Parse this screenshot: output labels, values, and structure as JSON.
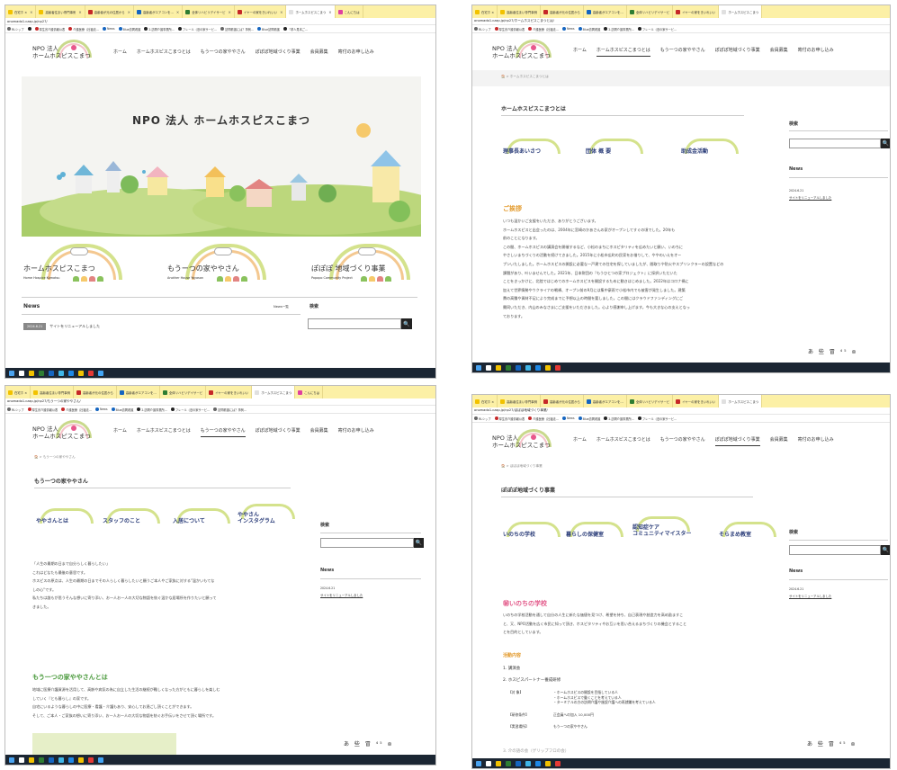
{
  "browser": {
    "tabs_long": [
      {
        "label": "在宅ホ ×",
        "color": "#f2c200"
      },
      {
        "label": "高齢者住まい専門事例",
        "color": "#f2c200"
      },
      {
        "label": "高齢者が元の住居から",
        "color": "#c62828"
      },
      {
        "label": "高齢者がエアコンを…",
        "color": "#1565c0"
      },
      {
        "label": "全体リハビリデイサービ",
        "color": "#2e7d32"
      },
      {
        "label": "イヤーの家をきいれいい",
        "color": "#c62828"
      },
      {
        "label": "ホームホスピスこまつ",
        "color": "#e0e0e0"
      },
      {
        "label": "こんにちは",
        "color": "#e040a0"
      }
    ],
    "bookmarks": [
      {
        "label": "RLシップ",
        "color": "#666"
      },
      {
        "label": "",
        "color": "#222"
      },
      {
        "label": "厚生省介護情報公表",
        "color": "#c62828"
      },
      {
        "label": "介護医療（社福法…",
        "color": "#c62828"
      },
      {
        "label": "News",
        "color": "#1565c0"
      },
      {
        "label": "Blue訪問看護",
        "color": "#1565c0"
      },
      {
        "label": "2.訪問介護事業所…",
        "color": "#222"
      },
      {
        "label": "フレール（旧の家サービ…",
        "color": "#222"
      },
      {
        "label": "訪問看護には？事例…",
        "color": "#666"
      },
      {
        "label": "Blue訪問看護",
        "color": "#1565c0"
      },
      {
        "label": "『求人見本ご…",
        "color": "#222"
      }
    ],
    "urls": [
      "onomado1.czap.jp/np27/",
      "onomado1.czap.jp/np27/ホームホスピスこまつとは/",
      "onomado1.czap.jp/np27/もう一つの家ややさん/",
      "onomado1.czap.jp/np27/ぽぽぽ地域づくり事業/"
    ]
  },
  "site": {
    "logo_line1": "NPO 法人",
    "logo_line2": "ホームホスピスこまつ",
    "nav": [
      "ホーム",
      "ホームホスピスこまつとは",
      "もう一つの家ややさん",
      "ぽぽぽ地域づくり事業",
      "会員募集",
      "寄付のお申し込み"
    ],
    "hero_title": "NPO 法人 ホームホスピスこまつ",
    "rainbow_cards": [
      {
        "main": "ホームホスピスこまつ",
        "sub": "Home Hospice Komatsu"
      },
      {
        "main": "もうーつの家ややさん",
        "sub": "Another House Yayasan"
      },
      {
        "main": "ぽぽぽ 地域づくり事業",
        "sub": "Popopo Community Project"
      }
    ],
    "news_heading": "News",
    "news_more": "News一覧",
    "search_heading": "検索",
    "news_date": "2024.6.21",
    "news_title": "サイトをリニューアルしました",
    "search_btn": "🔍"
  },
  "page_about": {
    "crumb": "🏠 > ホームホスピスこまつとは",
    "title": "ホームホスピスこまつとは",
    "buttons": [
      "理事長あいさつ",
      "団体 概 要",
      "助成金活動"
    ],
    "section": "ご挨拶",
    "para": [
      "いつも温かいご支援をいただき、ありがとうございます。",
      "ホームホスピスと出会ったのは、2004年に宮崎のかあさんの家がオープンしてすぐの頃でした。20年も",
      "前のことになります。",
      "この間、ホームホスピスの講演会を開催するなど、小松のまちにホスピタリティを広めたいと願い、いのちに",
      "やさしいまちづくりの活動を続けてきました。2015年に小松市広町の民家をお借りして、ややのいえをオー",
      "プンいたしました。ホームホスピスの開設に必要な一戸建ての住宅を探していましたが、間取りや防火やスプリンクラーの設置などの",
      "課題があり、叶いませんでした。2021年、日本財団の『もうひとつの家プロジェクト』に採択いただいた",
      "ことをきっかけに、北陸ではじめてのホームホスピスを開設するために動きはじめました。2022年はコロナ禍に",
      "加えて世界情勢やウクライナの戦禍、オープン前の9月には集中豪雨で小松市内でも被害が発生しました。建築",
      "費の高騰や資材不足により完成までに予想以上の時間を要しました。この間にはクラウドファンディングにご",
      "賛同いただき、内山のみなさまにご支援をいただきました。心より感謝申し上げます。今も大きな心の支えとなっ",
      "ております。"
    ],
    "side_search": "検索",
    "side_news": "News",
    "side_date": "2024.6.21",
    "side_link": "サイトをリニューアルしました",
    "ime": "あ 些 冒 ⁴⁵ ⊚"
  },
  "page_yaya": {
    "crumb": "🏠 > もう一つの家ややさん",
    "title": "もう一つの家ややさん",
    "buttons": [
      "ややさんとは",
      "スタッフのこと",
      "入居について",
      "ややさん\nインスタグラム"
    ],
    "quote": [
      "「人生の最期の日まで自分らしく暮らしたい」",
      "これはどなたも最後の意思です。",
      "ホスピスの原点は、人生の最期の日までその人らしく暮らしたいと願うご本人やご家族に対する\"温かいもてな",
      "しの心\"です。",
      "私たちは誰もが思うそんな想いに寄り添い、お一人お一人の大切な物語を紡ぐ温かな居場所を作りたいと願って",
      "きました。"
    ],
    "section": "もう一つの家ややさんとは",
    "para": [
      "地域に医療介護資源を活用して、高齢や病気の為に自立した生活の継続が難しくなった方がともに暮らしを楽しむ",
      "していく『とも暮らし』の家です。",
      "自宅にいるような暮らしの中に医療・看護・介護もあり、安心してお過ごし頂くことができます。",
      "そして、ご本人・ご家族の想いに寄り添い、お一人お一人の大切な物語を紡ぐお手伝いをさせて頂く場所です。"
    ],
    "side_search": "検索",
    "side_news": "News",
    "side_date": "2024.6.21",
    "side_link": "サイトをリニューアルしました",
    "ime": "あ 些 冒 ⁴⁵ ⊚"
  },
  "page_popo": {
    "crumb": "🏠 > ぽぽぽ地域づくり事業",
    "title": "ぽぽぽ地域づくり事業",
    "buttons": [
      "いのちの学校",
      "暮らしの保健室",
      "認知症ケア\nコミュニティマイスター",
      "そらまめ教室"
    ],
    "section": "㊙いのちの学校",
    "para": [
      "いのちの学校活動を通して自分の人生に新たな価値を見つけ、希望を持ち、自己表現や創造力を高め励ますこ",
      "と、又、NPO活動を広く市民に知って頂き、ホスピタリティやお互いを思い合えるまちづくりの機会とすること",
      "とを目的としています。"
    ],
    "activity_h": "活動内容",
    "list": [
      "1. 講演会",
      "2. ホスピスパートナー養成研修"
    ],
    "tbl": [
      {
        "k": "【対 象】",
        "v": "・ホームホスピスの開設を目指している人\n・ホームホスピスで働くことを考えている人\n・ターミナルの方の訪問介護や施設介護への再就職を考えている人"
      },
      {
        "k": "【研修条件】",
        "v": "正会員への加入 10,000円"
      },
      {
        "k": "【実習場所】",
        "v": "もう一つの家ややさん"
      }
    ],
    "list3": "3. 介の語の会（ゲリップフロの会）",
    "side_search": "検索",
    "side_news": "News",
    "side_date": "2024.6.21",
    "side_link": "サイトをリニューアルしました",
    "ime": "あ 些 冒 ⁴⁵ ⊚"
  },
  "colors": {
    "tab_bg": "#fcf0a6",
    "taskbar": "#1b2633",
    "rainbow": "#d4e28c",
    "orange": "#e39a2c",
    "green": "#4a9a3c"
  }
}
